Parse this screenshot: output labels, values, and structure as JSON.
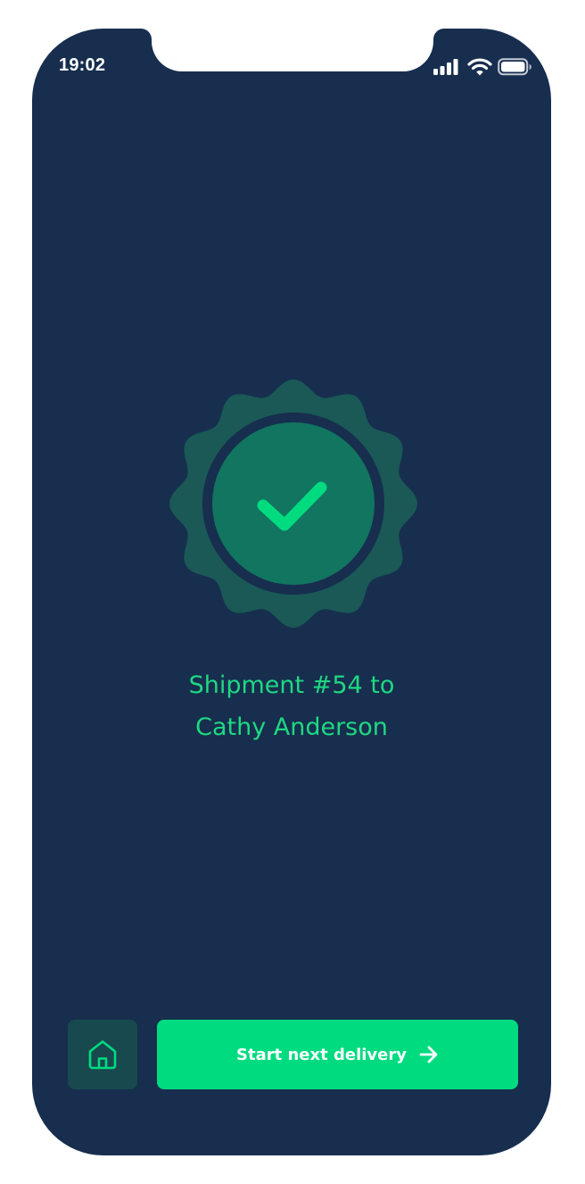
{
  "status_bar": {
    "time": "19:02",
    "icons": [
      "signal-bars-icon",
      "wifi-icon",
      "battery-icon"
    ]
  },
  "confirmation": {
    "icon": "check-badge-icon",
    "title_line_1": "Shipment #54 to",
    "title_line_2": "Cathy Anderson"
  },
  "actions": {
    "home_icon": "home-icon",
    "primary_label": "Start next delivery",
    "primary_icon": "arrow-right-icon"
  },
  "colors": {
    "background": "#172e4e",
    "accent": "#00db80",
    "badge_outer": "#1a5956",
    "badge_inner": "#117560",
    "home_button": "#17494f"
  }
}
